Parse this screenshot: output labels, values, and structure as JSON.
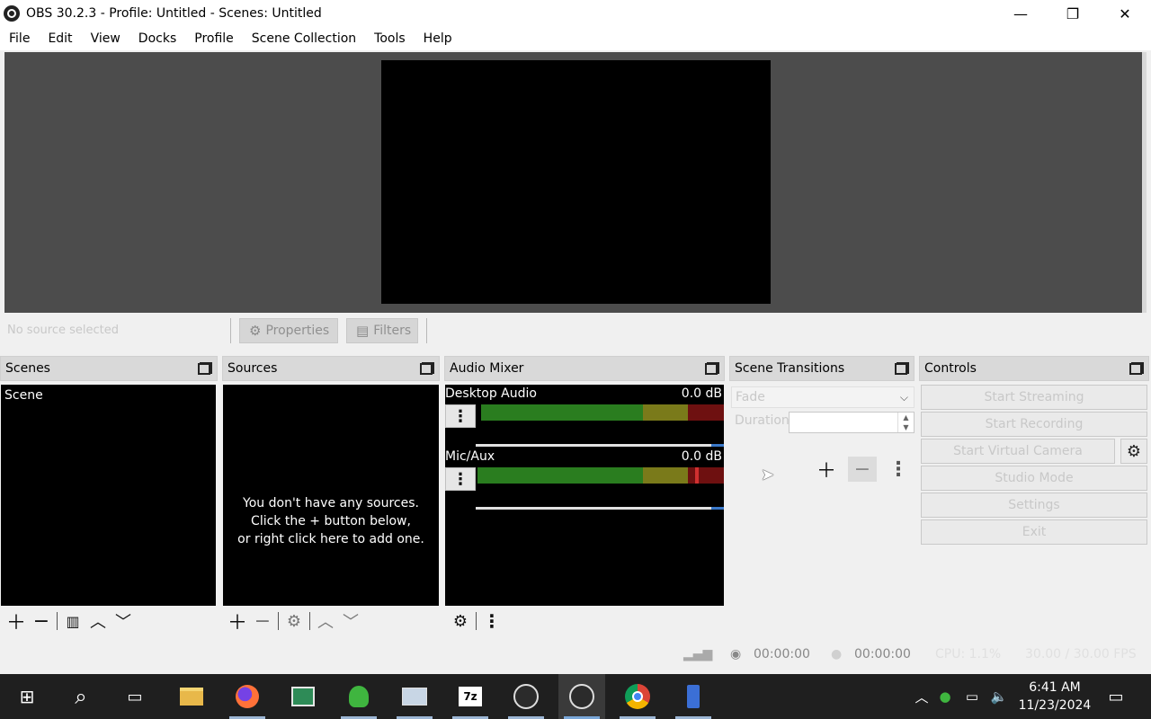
{
  "window": {
    "title": "OBS 30.2.3 - Profile: Untitled - Scenes: Untitled"
  },
  "window_controls": {
    "minimize": "—",
    "maximize": "❐",
    "close": "✕"
  },
  "menu": [
    "File",
    "Edit",
    "View",
    "Docks",
    "Profile",
    "Scene Collection",
    "Tools",
    "Help"
  ],
  "context_bar": {
    "no_source": "No source selected",
    "properties": "Properties",
    "filters": "Filters"
  },
  "docks": {
    "scenes": {
      "title": "Scenes",
      "items": [
        "Scene"
      ]
    },
    "sources": {
      "title": "Sources",
      "empty_line1": "You don't have any sources.",
      "empty_line2": "Click the + button below,",
      "empty_line3": "or right click here to add one."
    },
    "audio_mixer": {
      "title": "Audio Mixer",
      "channels": [
        {
          "name": "Desktop Audio",
          "db": "0.0 dB",
          "volume": 1.0
        },
        {
          "name": "Mic/Aux",
          "db": "0.0 dB",
          "volume": 1.0
        }
      ]
    },
    "scene_transitions": {
      "title": "Scene Transitions",
      "transition": "Fade",
      "duration_label": "Duration",
      "duration_value": ""
    },
    "controls": {
      "title": "Controls",
      "buttons": [
        "Start Streaming",
        "Start Recording",
        "Start Virtual Camera",
        "Studio Mode",
        "Settings",
        "Exit"
      ]
    }
  },
  "status": {
    "stream_time": "00:00:00",
    "record_time": "00:00:00",
    "cpu": "CPU: 1.1%",
    "fps": "30.00 / 30.00 FPS"
  },
  "taskbar": {
    "time": "6:41 AM",
    "date": "11/23/2024",
    "apps": [
      "start-icon",
      "search-icon",
      "task-view-icon",
      "file-explorer-icon",
      "firefox-icon",
      "app-icon",
      "messenger-icon",
      "network-app-icon",
      "7zip-icon",
      "obs-icon",
      "obs-icon",
      "chrome-icon",
      "usb-icon"
    ]
  },
  "colors": {
    "preview_bg": "#4c4c4c",
    "dock_body": "#000000",
    "meter_green": "#2a7d1f",
    "meter_yellow": "#7a7a1a",
    "meter_red": "#6e1010",
    "taskbar": "#1f1f1f"
  }
}
